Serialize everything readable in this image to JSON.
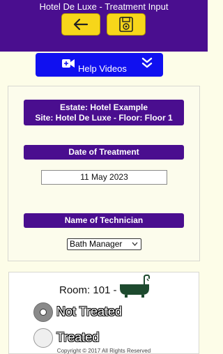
{
  "header": {
    "title": "Hotel De Luxe - Treatment Input",
    "back_icon": "arrow-left-icon",
    "save_icon": "save-disk-icon",
    "button_color": "#f7d61a",
    "bar_color": "#4a0e8f"
  },
  "help": {
    "label": "Help Videos",
    "icon": "video-camera-icon",
    "expand_icon": "double-chevron-down-icon",
    "color": "#1010f0"
  },
  "site": {
    "estate": "Estate: Hotel Example",
    "site_line": "Site: Hotel De Luxe - Floor: Floor 1"
  },
  "date": {
    "heading": "Date of Treatment",
    "value": "11 May 2023"
  },
  "technician": {
    "heading": "Name of Technician",
    "selected": "Bath Manager"
  },
  "room": {
    "label": "Room: 101 -",
    "icon": "bathtub-icon",
    "options": [
      {
        "label": "Not Treated",
        "selected": true
      },
      {
        "label": "Treated",
        "selected": false
      }
    ]
  },
  "footer": {
    "copyright": "Copyright © 2017 All Rights Reserved"
  }
}
